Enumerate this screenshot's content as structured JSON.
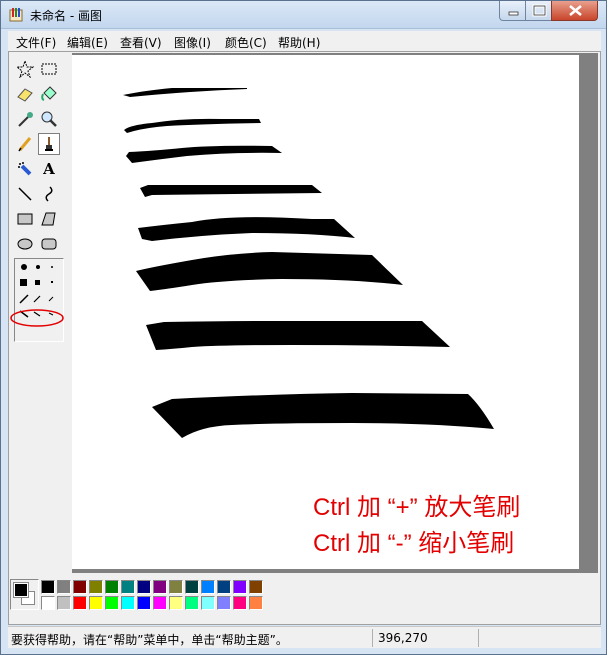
{
  "window": {
    "title": "未命名 - 画图"
  },
  "menu": [
    {
      "label": "文件(F)"
    },
    {
      "label": "编辑(E)"
    },
    {
      "label": "查看(V)"
    },
    {
      "label": "图像(I)"
    },
    {
      "label": "颜色(C)"
    },
    {
      "label": "帮助(H)"
    }
  ],
  "tools": [
    {
      "name": "free-select-tool",
      "icon": "star-select-icon"
    },
    {
      "name": "rect-select-tool",
      "icon": "dashed-rect-icon"
    },
    {
      "name": "eraser-tool",
      "icon": "eraser-icon"
    },
    {
      "name": "fill-tool",
      "icon": "paint-bucket-icon"
    },
    {
      "name": "pick-color-tool",
      "icon": "eyedropper-icon"
    },
    {
      "name": "magnifier-tool",
      "icon": "magnifier-icon"
    },
    {
      "name": "pencil-tool",
      "icon": "pencil-icon"
    },
    {
      "name": "brush-tool",
      "icon": "brush-icon",
      "active": true
    },
    {
      "name": "airbrush-tool",
      "icon": "airbrush-icon"
    },
    {
      "name": "text-tool",
      "icon": "text-a-icon"
    },
    {
      "name": "line-tool",
      "icon": "line-icon"
    },
    {
      "name": "curve-tool",
      "icon": "curve-icon"
    },
    {
      "name": "rectangle-tool",
      "icon": "rectangle-icon"
    },
    {
      "name": "polygon-tool",
      "icon": "polygon-icon"
    },
    {
      "name": "ellipse-tool",
      "icon": "ellipse-icon"
    },
    {
      "name": "rounded-rect-tool",
      "icon": "rounded-rect-icon"
    }
  ],
  "palette": {
    "foreground": "#000000",
    "background": "#ffffff",
    "top_row": [
      "#000000",
      "#808080",
      "#800000",
      "#808000",
      "#008000",
      "#008080",
      "#000080",
      "#800080",
      "#808040",
      "#004040",
      "#0080ff",
      "#004080",
      "#8000ff",
      "#804000"
    ],
    "bottom_row": [
      "#ffffff",
      "#c0c0c0",
      "#ff0000",
      "#ffff00",
      "#00ff00",
      "#00ffff",
      "#0000ff",
      "#ff00ff",
      "#ffff80",
      "#00ff80",
      "#80ffff",
      "#8080ff",
      "#ff0080",
      "#ff8040"
    ]
  },
  "annotation": {
    "line1": "Ctrl 加 “+” 放大笔刷",
    "line2": "Ctrl 加 “-”  缩小笔刷",
    "color": "#e30000"
  },
  "status": {
    "help_text": "要获得帮助，请在“帮助”菜单中，单击“帮助主题”。",
    "coords": "396,270"
  }
}
